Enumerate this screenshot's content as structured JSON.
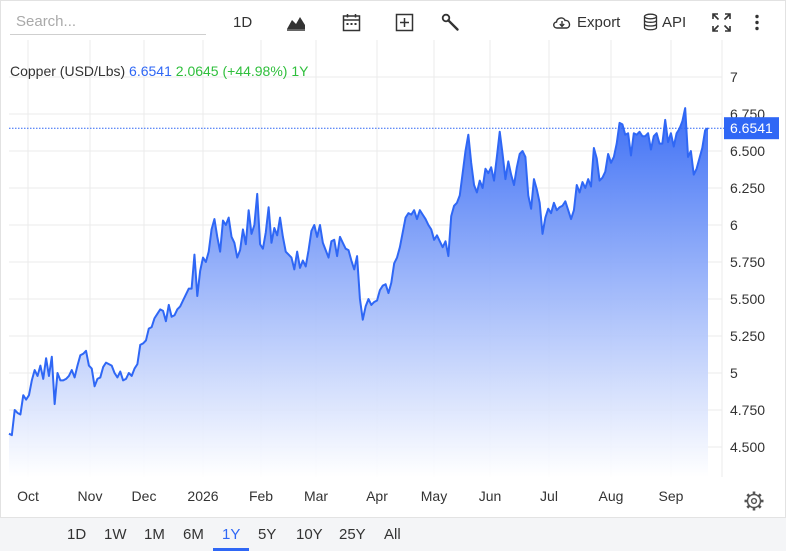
{
  "toolbar": {
    "search_placeholder": "Search...",
    "interval": "1D",
    "export_label": "Export",
    "api_label": "API"
  },
  "header": {
    "symbol": "Copper (USD/Lbs)",
    "price": "6.6541",
    "change": "2.0645 (+44.98%)",
    "period": "1Y"
  },
  "price_tag": "6.6541",
  "ranges": [
    {
      "label": "1D",
      "active": false
    },
    {
      "label": "1W",
      "active": false
    },
    {
      "label": "1M",
      "active": false
    },
    {
      "label": "6M",
      "active": false
    },
    {
      "label": "1Y",
      "active": true
    },
    {
      "label": "5Y",
      "active": false
    },
    {
      "label": "10Y",
      "active": false
    },
    {
      "label": "25Y",
      "active": false
    },
    {
      "label": "All",
      "active": false
    }
  ],
  "colors": {
    "line": "#2f67f5",
    "area_top": "#3d6ff5",
    "area_bottom": "#ffffff",
    "change_positive": "#2fbf3c",
    "grid": "#ebebeb"
  },
  "chart_data": {
    "type": "area",
    "title": "Copper (USD/Lbs)",
    "ylim": [
      4.3,
      7.2
    ],
    "y_ticks": [
      {
        "value": 7,
        "label": "7"
      },
      {
        "value": 6.75,
        "label": "6.750"
      },
      {
        "value": 6.5,
        "label": "6.500"
      },
      {
        "value": 6.25,
        "label": "6.250"
      },
      {
        "value": 6,
        "label": "6"
      },
      {
        "value": 5.75,
        "label": "5.750"
      },
      {
        "value": 5.5,
        "label": "5.500"
      },
      {
        "value": 5.25,
        "label": "5.250"
      },
      {
        "value": 5,
        "label": "5"
      },
      {
        "value": 4.75,
        "label": "4.750"
      },
      {
        "value": 4.5,
        "label": "4.500"
      }
    ],
    "x_ticks": [
      "Oct",
      "Nov",
      "Dec",
      "2026",
      "Feb",
      "Mar",
      "Apr",
      "May",
      "Jun",
      "Jul",
      "Aug",
      "Sep"
    ],
    "last_value": 6.6541,
    "grid": true,
    "series": [
      {
        "values": [
          4.59,
          4.58,
          4.75,
          4.73,
          4.72,
          4.85,
          4.82,
          4.85,
          4.95,
          5.02,
          4.98,
          5.05,
          4.96,
          5.1,
          4.98,
          5.11,
          4.79,
          5.0,
          4.95,
          4.95,
          4.96,
          4.98,
          5.02,
          4.97,
          5.05,
          5.12,
          5.13,
          5.15,
          5.05,
          5.03,
          4.91,
          4.96,
          4.97,
          5.04,
          5.07,
          5.06,
          5.05,
          5.0,
          4.97,
          5.01,
          4.95,
          4.96,
          5.0,
          4.98,
          5.03,
          5.06,
          5.19,
          5.2,
          5.22,
          5.3,
          5.31,
          5.37,
          5.4,
          5.43,
          5.42,
          5.35,
          5.46,
          5.38,
          5.39,
          5.43,
          5.45,
          5.49,
          5.53,
          5.57,
          5.57,
          5.8,
          5.52,
          5.69,
          5.78,
          5.75,
          5.82,
          5.97,
          6.04,
          5.92,
          5.82,
          6.03,
          6.0,
          6.05,
          5.92,
          5.88,
          5.78,
          5.83,
          5.97,
          5.87,
          6.1,
          5.94,
          6.0,
          6.21,
          5.87,
          5.84,
          5.95,
          6.12,
          5.88,
          5.98,
          5.93,
          6.05,
          5.92,
          5.82,
          5.8,
          5.78,
          5.7,
          5.82,
          5.71,
          5.76,
          5.72,
          5.83,
          5.96,
          6.0,
          5.92,
          6.0,
          5.88,
          5.83,
          5.78,
          5.89,
          5.9,
          5.79,
          5.92,
          5.88,
          5.84,
          5.83,
          5.76,
          5.7,
          5.79,
          5.5,
          5.36,
          5.45,
          5.5,
          5.46,
          5.48,
          5.49,
          5.56,
          5.59,
          5.6,
          5.54,
          5.61,
          5.74,
          5.78,
          5.85,
          5.95,
          6.05,
          6.08,
          6.07,
          6.1,
          6.04,
          6.1,
          6.07,
          6.04,
          6.0,
          5.97,
          5.9,
          5.93,
          5.89,
          5.85,
          5.89,
          5.79,
          6.06,
          6.13,
          6.15,
          6.2,
          6.35,
          6.5,
          6.61,
          6.42,
          6.27,
          6.22,
          6.3,
          6.25,
          6.38,
          6.35,
          6.39,
          6.3,
          6.46,
          6.63,
          6.48,
          6.31,
          6.43,
          6.34,
          6.27,
          6.39,
          6.48,
          6.5,
          6.46,
          6.2,
          6.11,
          6.31,
          6.24,
          6.15,
          5.94,
          6.05,
          6.11,
          6.08,
          6.15,
          6.1,
          6.12,
          6.13,
          6.16,
          6.1,
          6.04,
          6.1,
          6.27,
          6.22,
          6.29,
          6.25,
          6.31,
          6.26,
          6.52,
          6.45,
          6.3,
          6.32,
          6.36,
          6.48,
          6.42,
          6.46,
          6.55,
          6.69,
          6.68,
          6.61,
          6.62,
          6.47,
          6.62,
          6.61,
          6.63,
          6.6,
          6.6,
          6.62,
          6.51,
          6.6,
          6.62,
          6.55,
          6.55,
          6.71,
          6.56,
          6.62,
          6.53,
          6.62,
          6.65,
          6.7,
          6.79,
          6.46,
          6.5,
          6.34,
          6.38,
          6.45,
          6.52,
          6.64,
          6.6541
        ]
      }
    ]
  }
}
